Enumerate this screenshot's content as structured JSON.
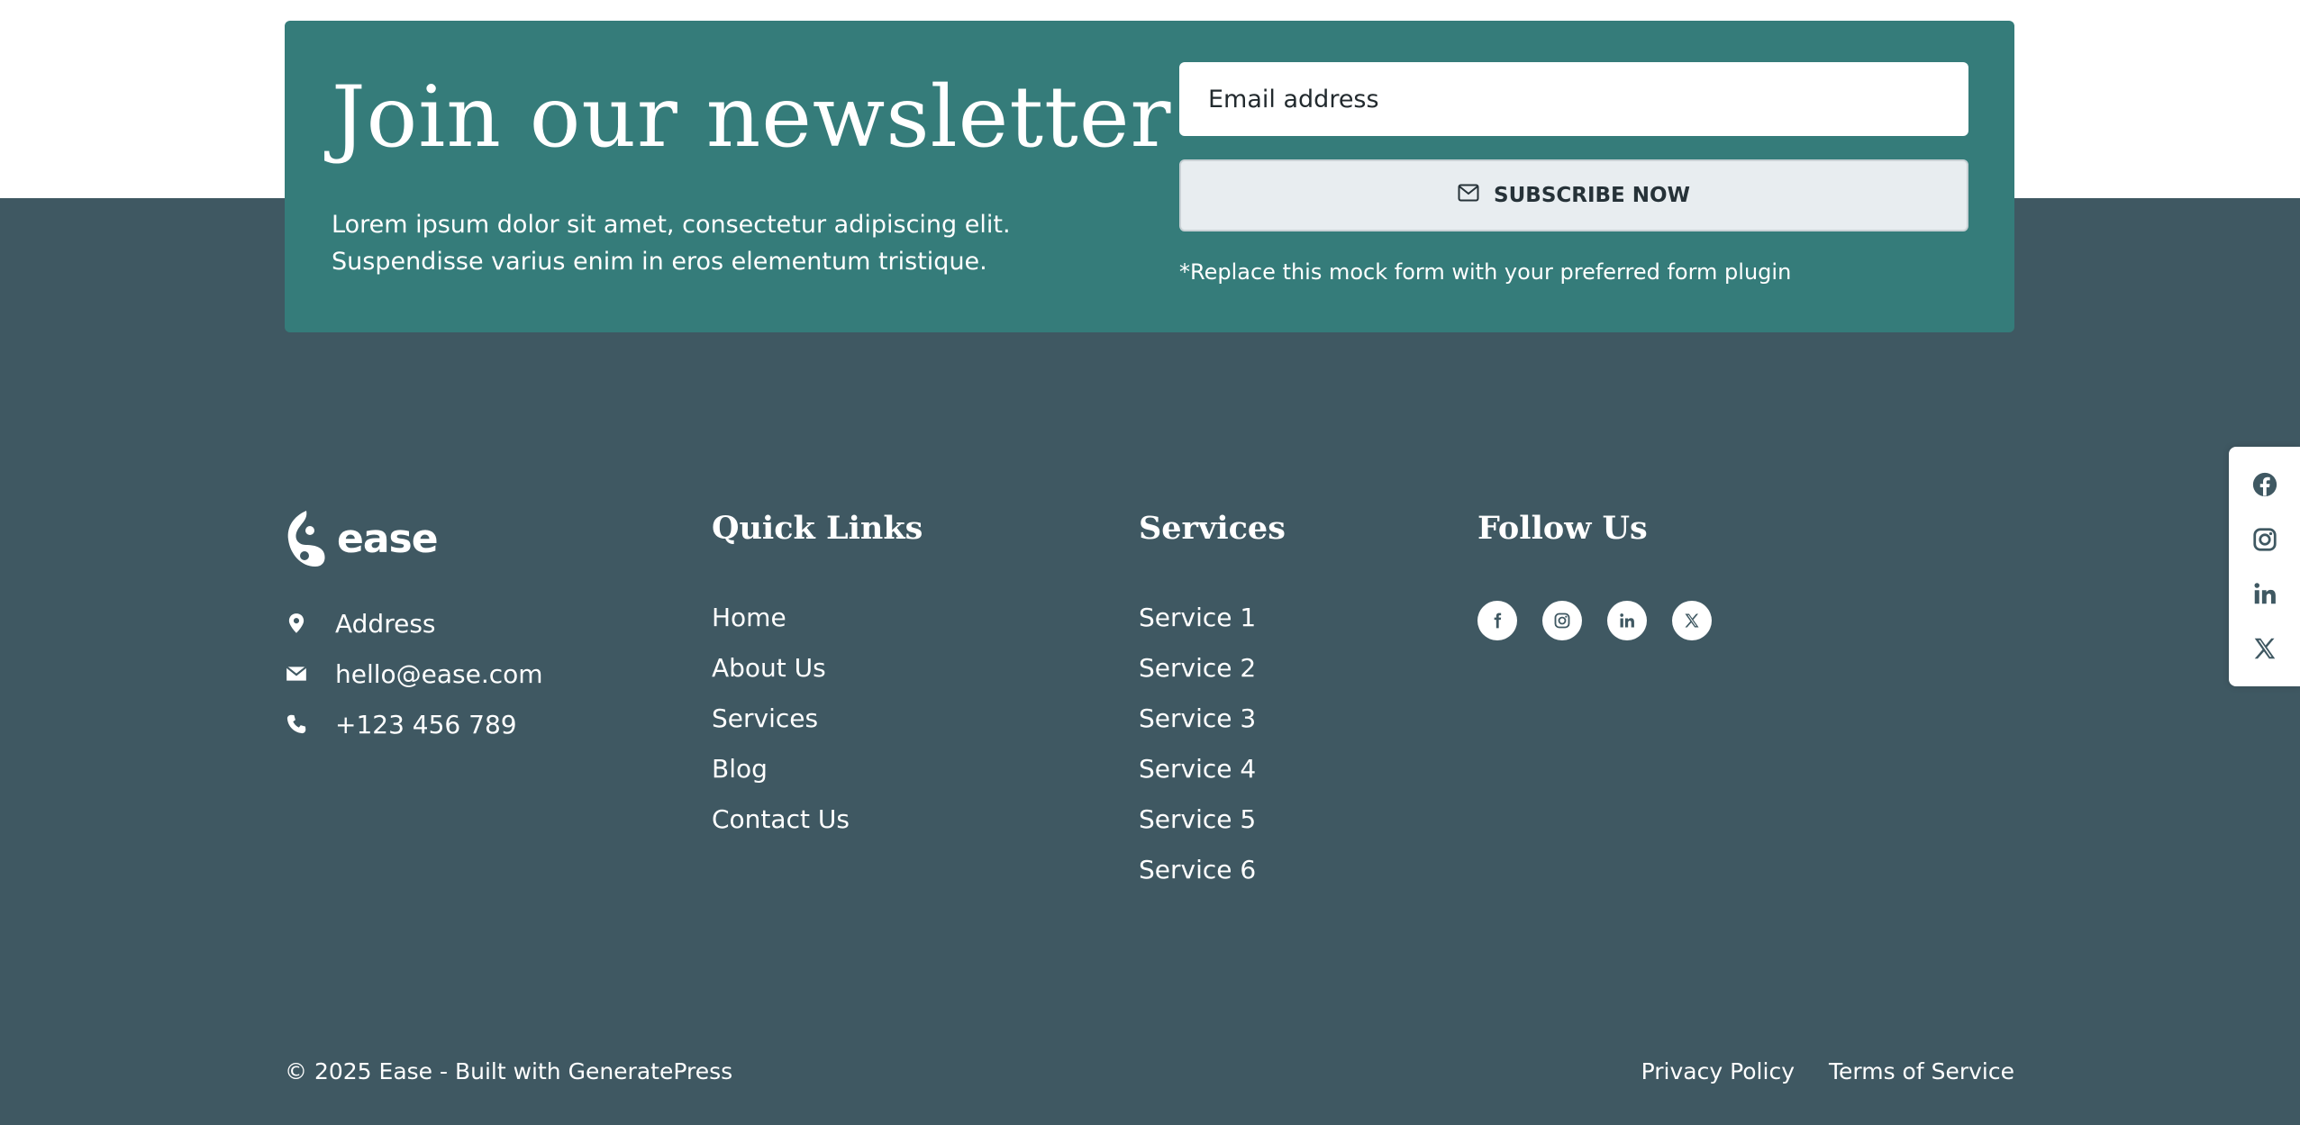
{
  "newsletter": {
    "title": "Join our newsletter",
    "text": "Lorem ipsum dolor sit amet, consectetur adipiscing elit. Suspendisse varius enim in eros elementum tristique.",
    "email_placeholder": "Email address",
    "subscribe_label": "SUBSCRIBE NOW",
    "subscribe_icon": "mail-icon",
    "note": "*Replace this mock form with your preferred form plugin"
  },
  "brand": {
    "name": "ease",
    "logo_icon": "yin-yang-leaf-logo"
  },
  "contact": [
    {
      "icon": "location-pin-icon",
      "text": "Address"
    },
    {
      "icon": "envelope-icon",
      "text": "hello@ease.com"
    },
    {
      "icon": "phone-icon",
      "text": "+123 456 789"
    }
  ],
  "quick_links": {
    "heading": "Quick Links",
    "items": [
      "Home",
      "About Us",
      "Services",
      "Blog",
      "Contact Us"
    ]
  },
  "services": {
    "heading": "Services",
    "items": [
      "Service 1",
      "Service 2",
      "Service 3",
      "Service 4",
      "Service 5",
      "Service 6"
    ]
  },
  "follow": {
    "heading": "Follow Us",
    "icons": [
      "facebook-icon",
      "instagram-icon",
      "linkedin-icon",
      "x-icon"
    ]
  },
  "footer": {
    "copyright": "© 2025 Ease - Built with GeneratePress",
    "links": [
      "Privacy Policy",
      "Terms of Service"
    ]
  },
  "floating_social": {
    "icons": [
      "facebook-icon",
      "instagram-icon",
      "linkedin-icon",
      "x-icon"
    ]
  },
  "colors": {
    "footer_bg": "#3f5862",
    "newsletter_bg": "#357c7a",
    "button_bg": "#e8edf0",
    "text": "#ffffff"
  }
}
